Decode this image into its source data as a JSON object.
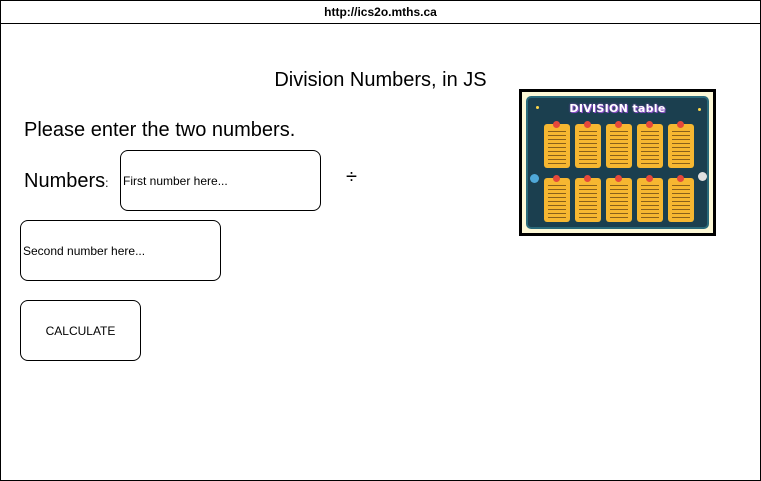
{
  "browser": {
    "url": "http://ics2o.mths.ca"
  },
  "page": {
    "title": "Division Numbers, in JS",
    "instructions": "Please enter the two numbers.",
    "numbers_label": "Numbers",
    "numbers_colon": ":",
    "divide_symbol": "÷",
    "first_input": {
      "placeholder": "First number here...",
      "value": ""
    },
    "second_input": {
      "placeholder": "Second number here...",
      "value": ""
    },
    "calculate_label": "CALCULATE",
    "poster": {
      "title": "DIVISION table",
      "icon": "division-table-image"
    }
  }
}
